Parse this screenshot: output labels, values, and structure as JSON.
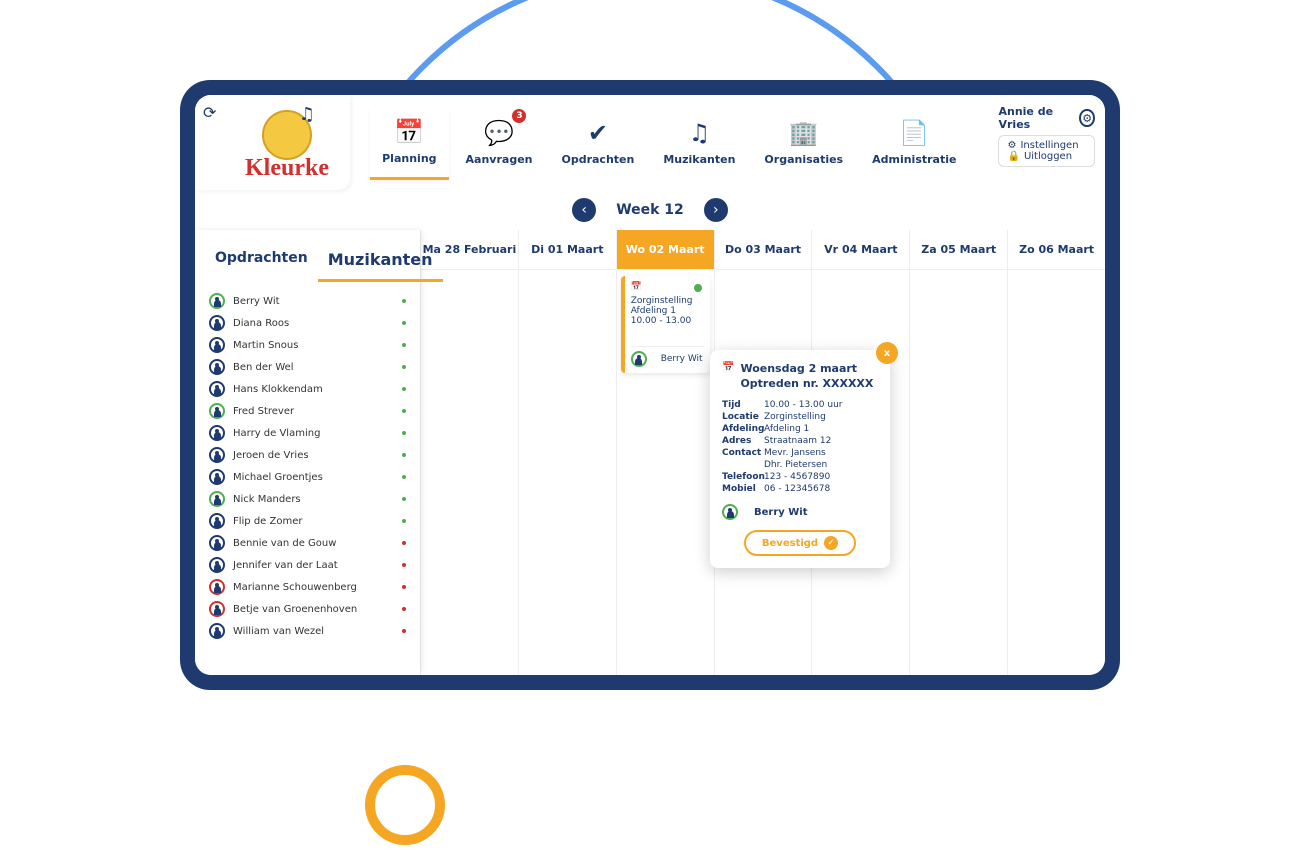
{
  "brand": "Kleurke",
  "nav": [
    {
      "label": "Planning",
      "icon": "📅",
      "active": true
    },
    {
      "label": "Aanvragen",
      "icon": "💬",
      "badge": "3"
    },
    {
      "label": "Opdrachten",
      "icon": "✔"
    },
    {
      "label": "Muzikanten",
      "icon": "♫"
    },
    {
      "label": "Organisaties",
      "icon": "🏢"
    },
    {
      "label": "Administratie",
      "icon": "📄"
    }
  ],
  "user": {
    "name": "Annie de Vries",
    "links": [
      "Instellingen",
      "Uitloggen"
    ]
  },
  "week": {
    "label": "Week 12"
  },
  "sidebarTabs": [
    "Opdrachten",
    "Muzikanten"
  ],
  "musicians": [
    {
      "name": "Berry Wit",
      "ring": "#4caf50",
      "status": "#4caf50"
    },
    {
      "name": "Diana Roos",
      "ring": "#1e3a6e",
      "status": "#4caf50"
    },
    {
      "name": "Martin Snous",
      "ring": "#1e3a6e",
      "status": "#4caf50"
    },
    {
      "name": "Ben der Wel",
      "ring": "#1e3a6e",
      "status": "#4caf50"
    },
    {
      "name": "Hans Klokkendam",
      "ring": "#1e3a6e",
      "status": "#4caf50"
    },
    {
      "name": "Fred Strever",
      "ring": "#4caf50",
      "status": "#4caf50"
    },
    {
      "name": "Harry de Vlaming",
      "ring": "#1e3a6e",
      "status": "#4caf50"
    },
    {
      "name": "Jeroen de Vries",
      "ring": "#1e3a6e",
      "status": "#4caf50"
    },
    {
      "name": "Michael Groentjes",
      "ring": "#1e3a6e",
      "status": "#4caf50"
    },
    {
      "name": "Nick Manders",
      "ring": "#4caf50",
      "status": "#4caf50"
    },
    {
      "name": "Flip de Zomer",
      "ring": "#1e3a6e",
      "status": "#4caf50"
    },
    {
      "name": "Bennie van de Gouw",
      "ring": "#1e3a6e",
      "status": "#d32f2f"
    },
    {
      "name": "Jennifer van der Laat",
      "ring": "#1e3a6e",
      "status": "#d32f2f"
    },
    {
      "name": "Marianne Schouwenberg",
      "ring": "#d32f2f",
      "status": "#d32f2f"
    },
    {
      "name": "Betje van Groenenhoven",
      "ring": "#d32f2f",
      "status": "#d32f2f"
    },
    {
      "name": "William van Wezel",
      "ring": "#1e3a6e",
      "status": "#d32f2f"
    }
  ],
  "days": [
    "Ma 28 Februari",
    "Di 01 Maart",
    "Wo 02 Maart",
    "Do 03 Maart",
    "Vr 04 Maart",
    "Za 05 Maart",
    "Zo 06 Maart"
  ],
  "activeDay": 2,
  "event": {
    "org": "Zorginstelling",
    "dept": "Afdeling 1",
    "time": "10.00 - 13.00",
    "person": "Berry Wit"
  },
  "popup": {
    "title": "Woensdag 2 maart",
    "subtitle": "Optreden nr. XXXXXX",
    "rows": [
      {
        "label": "Tijd",
        "value": "10.00 - 13.00 uur"
      },
      {
        "label": "Locatie",
        "value": "Zorginstelling"
      },
      {
        "label": "Afdeling",
        "value": "Afdeling 1"
      },
      {
        "label": "Adres",
        "value": "Straatnaam 12"
      },
      {
        "label": "Contact",
        "value": "Mevr. Jansens"
      },
      {
        "label": "",
        "value": "Dhr. Pietersen"
      },
      {
        "label": "Telefoon",
        "value": "123 - 4567890"
      },
      {
        "label": "Mobiel",
        "value": "06 - 12345678"
      }
    ],
    "person": "Berry Wit",
    "button": "Bevestigd"
  }
}
